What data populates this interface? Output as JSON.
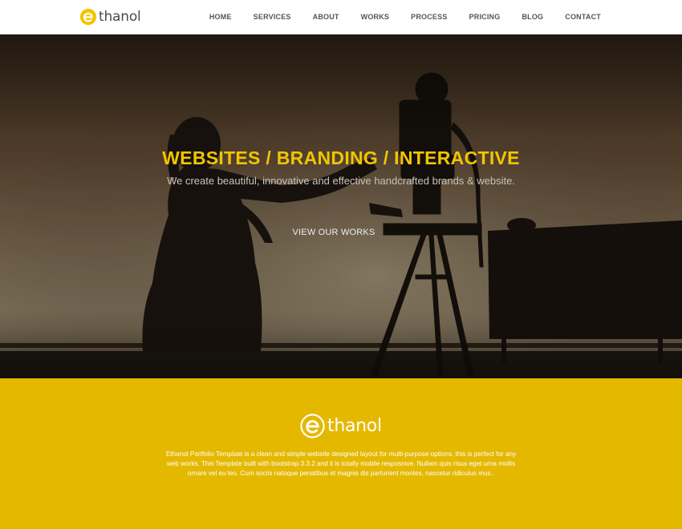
{
  "navbar": {
    "brand_text": "thanol",
    "brand_icon": "ethanol-e-logo-icon",
    "items": [
      {
        "label": "HOME"
      },
      {
        "label": "SERVICES"
      },
      {
        "label": "ABOUT"
      },
      {
        "label": "WORKS"
      },
      {
        "label": "PROCESS"
      },
      {
        "label": "PRICING"
      },
      {
        "label": "BLOG"
      },
      {
        "label": "CONTACT"
      }
    ]
  },
  "hero": {
    "title": "WEBSITES / BRANDING / INTERACTIVE",
    "subtitle": "We create beautiful, innovative and effective handcrafted brands & website.",
    "cta_label": "VIEW OUR WORKS",
    "background_image": "silhouette of a person operating a camera on a tripod"
  },
  "about": {
    "logo_text": "thanol",
    "logo_icon": "ethanol-e-logo-icon",
    "description": "Ethanol Portfolio Template is a clean and simple website designed layout for multi-purpose options, this is perfect for any web works. This Template built with bootstrap 3.3.2 and it is totally mobile resposnive. Nullam quis risus eget urna mollis ornare vel eu leo. Cum sociis natoque penatibus et magnis dis parturient montes, nascetur ridiculus mus.."
  },
  "colors": {
    "accent": "#f2c500",
    "about_bg": "#e5b800",
    "nav_text": "#555555"
  }
}
